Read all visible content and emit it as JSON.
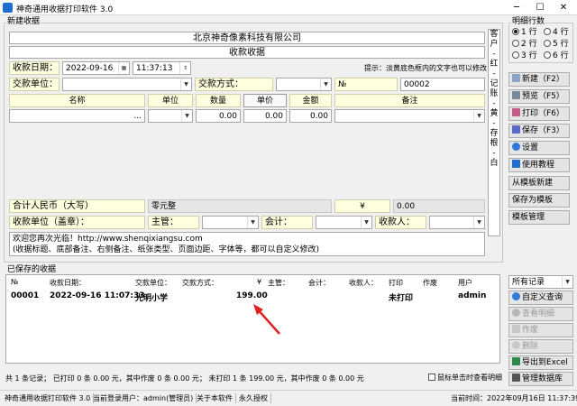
{
  "window": {
    "title": "神奇通用收据打印软件 3.0"
  },
  "form": {
    "group_label": "新建收据",
    "company": "北京神奇像素科技有限公司",
    "doc_title": "收款收据",
    "date_label": "收款日期：",
    "date_value": "2022-09-16",
    "time_value": "11:37:13",
    "tip": "提示：淡黄底色框内的文字也可以修改",
    "unit_label": "交款单位：",
    "method_label": "交款方式：",
    "no_label": "№",
    "no_value": "00002",
    "columns": {
      "name": "名称",
      "unit": "单位",
      "qty": "数量",
      "price": "单价",
      "amount": "金额",
      "note": "备注"
    },
    "row": {
      "name": "...",
      "qty": "0.00",
      "price": "0.00",
      "amount": "0.00"
    },
    "total_label": "合计人民币（大写）",
    "total_value": "零元整",
    "yen": "¥",
    "yen_value": "0.00",
    "payee_label": "收款单位（盖章）：",
    "manager_label": "主管：",
    "accountant_label": "会计：",
    "receiver_label": "收款人：",
    "footer_note_1": "欢迎您再次光临！http://www.shenqixiangsu.com",
    "footer_note_2": "(收据标题、底部备注、右侧备注、纸张类型、页面边距、字体等，都可以自定义修改)",
    "side_text": [
      "客",
      "户",
      "-",
      "红",
      "-",
      "记",
      "账",
      "-",
      "黄",
      "-",
      "存",
      "根",
      "-",
      "白"
    ]
  },
  "copies": {
    "label": "明细行数",
    "options": [
      {
        "label": "1 行",
        "selected": true
      },
      {
        "label": "4 行",
        "selected": false
      },
      {
        "label": "2 行",
        "selected": false
      },
      {
        "label": "5 行",
        "selected": false
      },
      {
        "label": "3 行",
        "selected": false
      },
      {
        "label": "6 行",
        "selected": false
      }
    ]
  },
  "buttons": {
    "new": "新建（F2）",
    "preview": "预览（F5）",
    "print": "打印（F6）",
    "save": "保存（F3）",
    "settings": "设置",
    "tutorial": "使用教程",
    "from_template": "从模板新建",
    "save_template": "保存为模板",
    "manage_template": "模板管理",
    "filter": "所有记录",
    "custom_query": "自定义查询",
    "view_detail": "查看明细",
    "void": "作废",
    "delete": "删除",
    "export": "导出到Excel",
    "manage_db": "管理数据库"
  },
  "saved": {
    "label": "已保存的收据",
    "headers": [
      "№",
      "收款日期：",
      "交款单位：",
      "交款方式：",
      "¥",
      "主管：",
      "会计：",
      "收款人：",
      "打印",
      "作废",
      "用户"
    ],
    "rows": [
      {
        "no": "00001",
        "date": "2022-09-16 11:07:33",
        "unit": "光明小学",
        "method": "",
        "amount": "199.00",
        "manager": "",
        "accountant": "",
        "receiver": "",
        "printed": "未打印",
        "void": "",
        "user": "admin"
      }
    ]
  },
  "summary": {
    "text": "共 1 条记录；  已打印 0 条 0.00 元，其中作废 0 条 0.00 元；  未打印 1 条 199.00 元，其中作废 0 条 0.00 元",
    "checkbox": "鼠标单击时查看明细"
  },
  "status": {
    "app": "神奇通用收据打印软件 3.0",
    "user": "当前登录用户：admin(管理员)",
    "about": "关于本软件",
    "license": "永久授权",
    "time": "当前时间：2022年09月16日 11:37:39"
  },
  "colors": {
    "accent": "#1f6fd1",
    "arrow": "#e02020",
    "yellow": "#ffffe0"
  }
}
